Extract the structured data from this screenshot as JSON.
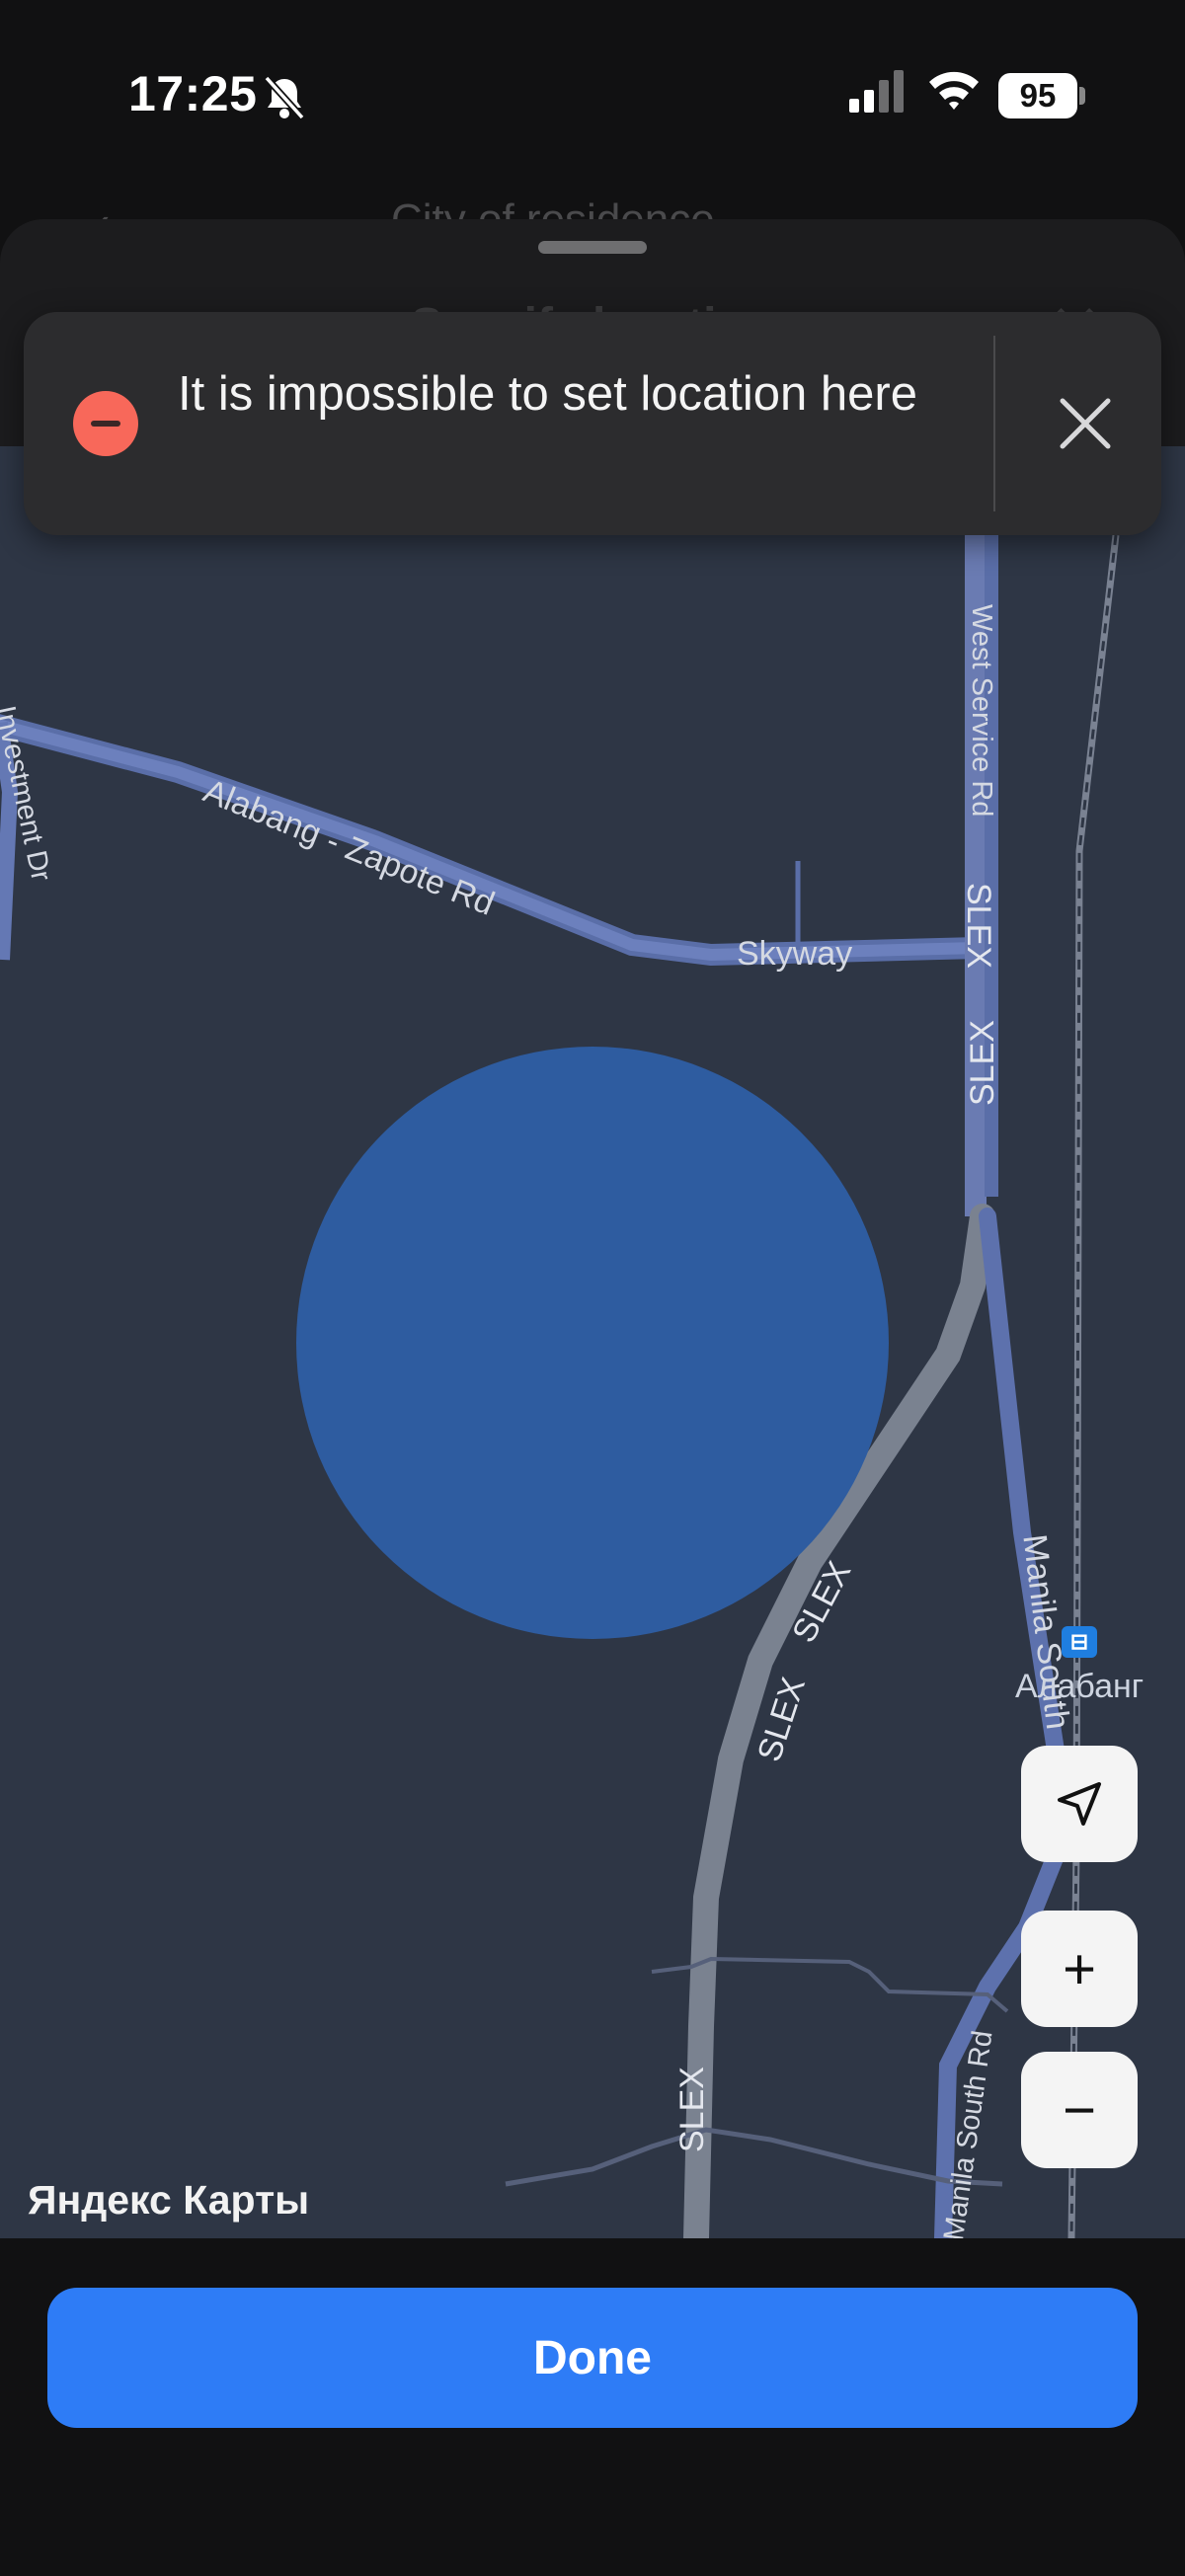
{
  "status_bar": {
    "time": "17:25",
    "battery": "95"
  },
  "sheet": {
    "back_label": "‹",
    "behind_title": "City of residence",
    "title": "Specify location",
    "close_glyph": "✕"
  },
  "toast": {
    "message": "It is impossible to set location here"
  },
  "map": {
    "watermark": "Яндекс Карты",
    "station": "Алабанг",
    "roads": {
      "alabang_zapote": "Alabang - Zapote Rd",
      "skyway": "Skyway",
      "west_service": "West Service Rd",
      "slex": "SLEX",
      "manila_south": "Manila South",
      "manila_south_rd": "Manila South Rd",
      "investment_dr": "Investment Dr"
    }
  },
  "controls": {
    "zoom_in": "+",
    "zoom_out": "−"
  },
  "footer": {
    "done_label": "Done"
  }
}
